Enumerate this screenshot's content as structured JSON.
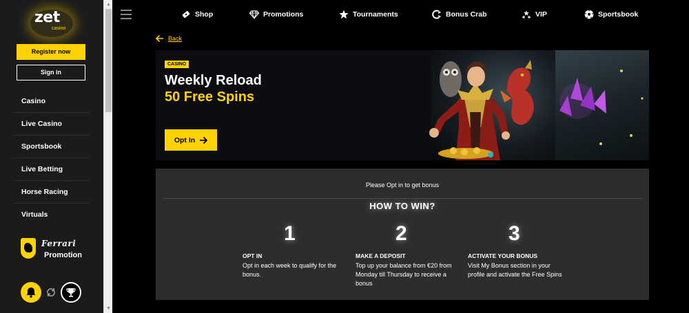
{
  "sidebar": {
    "logo_text": "zet",
    "logo_sub": "casino",
    "register_label": "Register now",
    "signin_label": "Sign in",
    "nav": [
      "Casino",
      "Live Casino",
      "Sportsbook",
      "Live Betting",
      "Horse Racing",
      "Virtuals"
    ],
    "ferrari_brand": "Ferrari",
    "ferrari_promo": "Promotion",
    "icons": [
      "bell-icon",
      "swap-icon",
      "trophy-icon"
    ]
  },
  "topnav": {
    "items": [
      {
        "label": "Shop",
        "icon": "ticket-icon"
      },
      {
        "label": "Promotions",
        "icon": "diamond-icon"
      },
      {
        "label": "Tournaments",
        "icon": "star-icon"
      },
      {
        "label": "Bonus Crab",
        "icon": "crab-icon"
      },
      {
        "label": "VIP",
        "icon": "stars-icon"
      },
      {
        "label": "Sportsbook",
        "icon": "soccer-ball-icon"
      }
    ]
  },
  "main": {
    "back_label": "Back",
    "banner": {
      "badge": "CASINO",
      "title": "Weekly Reload",
      "subtitle": "50 Free Spins",
      "optin_label": "Opt In"
    },
    "info": {
      "prompt": "Please Opt in to get bonus",
      "howto": "HOW TO WIN?",
      "steps": [
        {
          "num": "1",
          "title": "OPT IN",
          "desc": "Opt in each week to qualify for the bonus."
        },
        {
          "num": "2",
          "title": "MAKE A DEPOSIT",
          "desc": "Top up your balance from €20 from Monday till Thursday to receive a bonus"
        },
        {
          "num": "3",
          "title": "ACTIVATE YOUR BONUS",
          "desc": "Visit My Bonus section in your profile and activate the Free Spins"
        }
      ]
    }
  },
  "colors": {
    "accent": "#ffd200",
    "sidebar_bg": "#1b1b1b",
    "info_bg": "#2d2d2d"
  }
}
